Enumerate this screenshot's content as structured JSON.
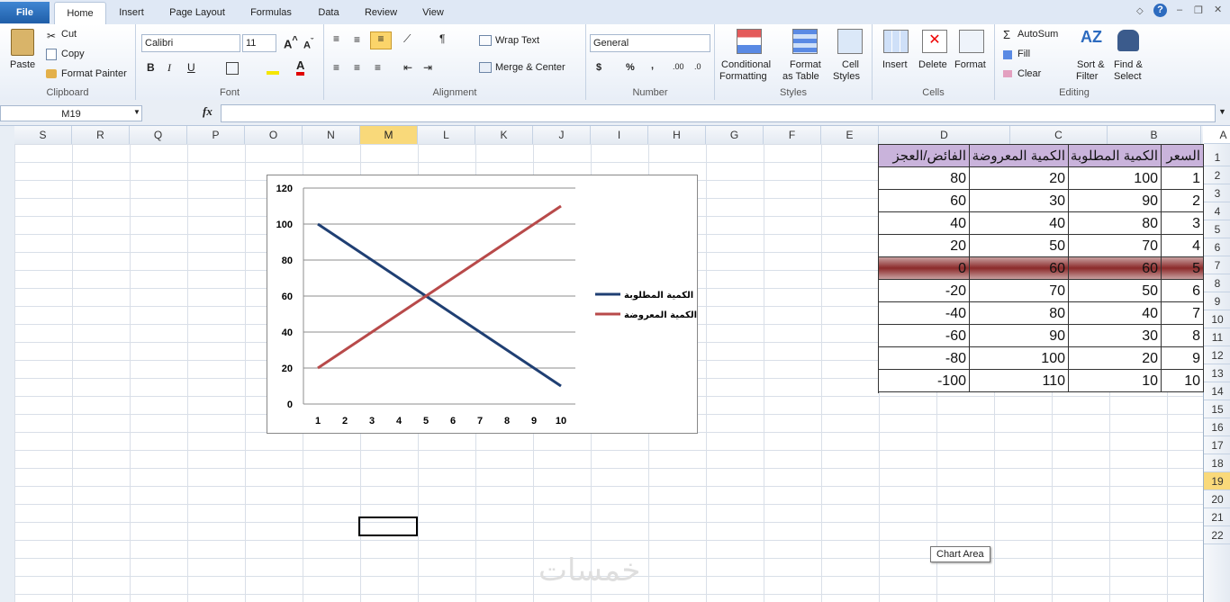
{
  "tabs": {
    "file": "File",
    "home": "Home",
    "insert": "Insert",
    "page_layout": "Page Layout",
    "formulas": "Formulas",
    "data": "Data",
    "review": "Review",
    "view": "View"
  },
  "ribbon": {
    "clipboard": {
      "label": "Clipboard",
      "paste": "Paste",
      "cut": "Cut",
      "copy": "Copy",
      "format_painter": "Format Painter"
    },
    "font": {
      "label": "Font",
      "name": "Calibri",
      "size": "11"
    },
    "alignment": {
      "label": "Alignment",
      "wrap_text": "Wrap Text",
      "merge_center": "Merge & Center"
    },
    "number": {
      "label": "Number",
      "format": "General"
    },
    "styles": {
      "label": "Styles",
      "conditional_1": "Conditional",
      "conditional_2": "Formatting",
      "format_table_1": "Format",
      "format_table_2": "as Table",
      "cell_styles_1": "Cell",
      "cell_styles_2": "Styles"
    },
    "cells": {
      "label": "Cells",
      "insert": "Insert",
      "delete": "Delete",
      "format": "Format"
    },
    "editing": {
      "label": "Editing",
      "autosum": "AutoSum",
      "fill": "Fill",
      "clear": "Clear",
      "sort_1": "Sort &",
      "sort_2": "Filter",
      "find_1": "Find &",
      "find_2": "Select"
    }
  },
  "formula_bar": {
    "name_box": "M19",
    "fx": "fx",
    "formula": ""
  },
  "columns": [
    "S",
    "R",
    "Q",
    "P",
    "O",
    "N",
    "M",
    "L",
    "K",
    "J",
    "I",
    "H",
    "G",
    "F",
    "E",
    "D",
    "C",
    "B",
    "A"
  ],
  "selected_column": "M",
  "rows": [
    "1",
    "2",
    "3",
    "4",
    "5",
    "6",
    "7",
    "8",
    "9",
    "10",
    "11",
    "12",
    "13",
    "14",
    "15",
    "16",
    "17",
    "18",
    "19",
    "20",
    "21",
    "22"
  ],
  "selected_row": "19",
  "table": {
    "headers": {
      "A": "السعر",
      "B": "الكمية المطلوبة",
      "C": "الكمية المعروضة",
      "D": "الفائض/العجز"
    },
    "rows": [
      [
        "1",
        "100",
        "20",
        "80"
      ],
      [
        "2",
        "90",
        "30",
        "60"
      ],
      [
        "3",
        "80",
        "40",
        "40"
      ],
      [
        "4",
        "70",
        "50",
        "20"
      ],
      [
        "5",
        "60",
        "60",
        "0"
      ],
      [
        "6",
        "50",
        "70",
        "-20"
      ],
      [
        "7",
        "40",
        "80",
        "-40"
      ],
      [
        "8",
        "30",
        "90",
        "-60"
      ],
      [
        "9",
        "20",
        "100",
        "-80"
      ],
      [
        "10",
        "10",
        "110",
        "-100"
      ]
    ]
  },
  "chart_data": {
    "type": "line",
    "x": [
      1,
      2,
      3,
      4,
      5,
      6,
      7,
      8,
      9,
      10
    ],
    "series": [
      {
        "name": "الكمية المطلوبة",
        "values": [
          100,
          90,
          80,
          70,
          60,
          50,
          40,
          30,
          20,
          10
        ],
        "color": "#1f3f73"
      },
      {
        "name": "الكمية المعروضة",
        "values": [
          20,
          30,
          40,
          50,
          60,
          70,
          80,
          90,
          100,
          110
        ],
        "color": "#b84a4a"
      }
    ],
    "ylim": [
      0,
      120
    ],
    "yticks": [
      0,
      20,
      40,
      60,
      80,
      100,
      120
    ],
    "grid": true,
    "legend": "right"
  },
  "tooltip": "Chart Area",
  "watermark": "خمسات"
}
